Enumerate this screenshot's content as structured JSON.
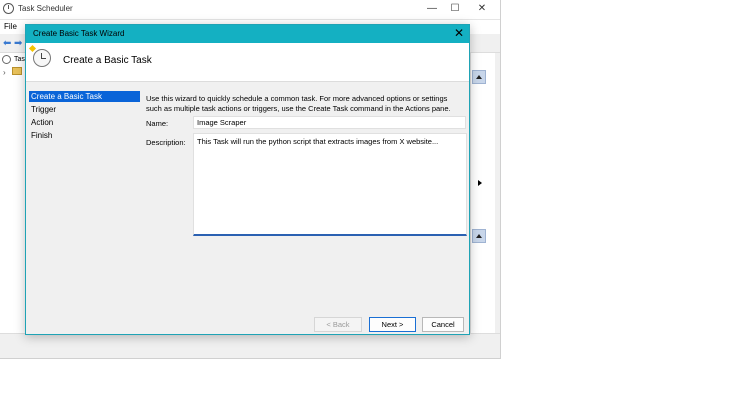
{
  "background_app": {
    "title": "Task Scheduler",
    "menu": [
      "File"
    ],
    "tree_item": "Task",
    "controls": {
      "minimize": "—",
      "maximize": "☐",
      "close": "✕"
    }
  },
  "wizard": {
    "title": "Create Basic Task Wizard",
    "header_title": "Create a Basic Task",
    "nav": [
      "Create a Basic Task",
      "Trigger",
      "Action",
      "Finish"
    ],
    "active_nav": 0,
    "intro": "Use this wizard to quickly schedule a common task.  For more advanced options or settings such as multiple task actions or triggers, use the Create Task command in the Actions pane.",
    "name_label": "Name:",
    "name_value": "Image Scraper",
    "description_label": "Description:",
    "description_value": "This Task will run the python script that extracts images from X website...",
    "buttons": {
      "back": "< Back",
      "next": "Next >",
      "cancel": "Cancel"
    },
    "close_glyph": "✕"
  },
  "colors": {
    "wizard_titlebar": "#14b0c2",
    "nav_active": "#0a64d8",
    "focus_underline": "#2b61b2"
  }
}
